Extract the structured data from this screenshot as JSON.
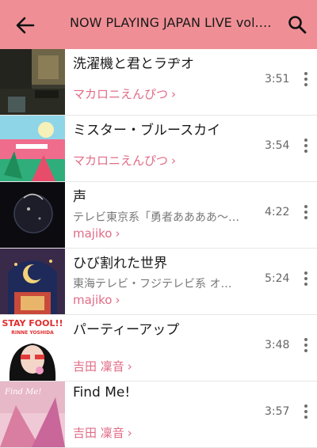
{
  "header": {
    "title": "NOW PLAYING JAPAN LIVE vol.…",
    "back_icon": "arrow-left-icon",
    "search_icon": "search-icon",
    "background": "#ef8f95"
  },
  "accent_color": "#e16b86",
  "tracks": [
    {
      "title": "洗濯機と君とラヂオ",
      "subtitle": "",
      "artist": "マカロニえんぴつ",
      "duration": "3:51"
    },
    {
      "title": "ミスター・ブルースカイ",
      "subtitle": "",
      "artist": "マカロニえんぴつ",
      "duration": "3:54"
    },
    {
      "title": "声",
      "subtitle": "テレビ東京系「勇者ああああ～…",
      "artist": "majiko",
      "duration": "4:22"
    },
    {
      "title": "ひび割れた世界",
      "subtitle": "東海テレビ・フジテレビ系 オ…",
      "artist": "majiko",
      "duration": "5:24"
    },
    {
      "title": "パーティーアップ",
      "subtitle": "",
      "artist": "吉田 凜音",
      "duration": "3:48"
    },
    {
      "title": "Find Me!",
      "subtitle": "",
      "artist": "吉田 凜音",
      "duration": "3:57"
    }
  ],
  "artwork": {
    "art5_text_1": "STAY FOOL!!",
    "art5_text_2": "RINNE YOSHIDA",
    "art6_text": "Find Me!"
  }
}
